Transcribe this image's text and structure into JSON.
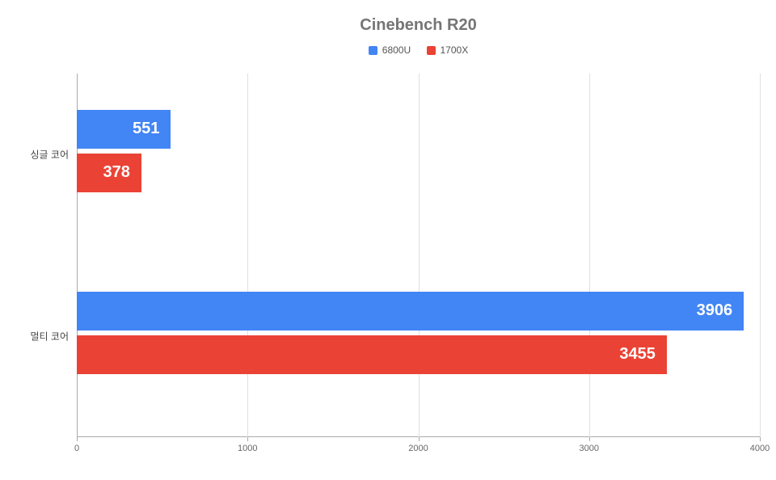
{
  "chart_data": {
    "type": "bar",
    "orientation": "horizontal",
    "title": "Cinebench R20",
    "categories": [
      "싱글 코어",
      "멀티 코어"
    ],
    "series": [
      {
        "name": "6800U",
        "color": "#4285f4",
        "values": [
          551,
          3906
        ]
      },
      {
        "name": "1700X",
        "color": "#ea4335",
        "values": [
          378,
          3455
        ]
      }
    ],
    "xlim": [
      0,
      4000
    ],
    "xticks": [
      0,
      1000,
      2000,
      3000,
      4000
    ],
    "xlabel": "",
    "ylabel": ""
  }
}
